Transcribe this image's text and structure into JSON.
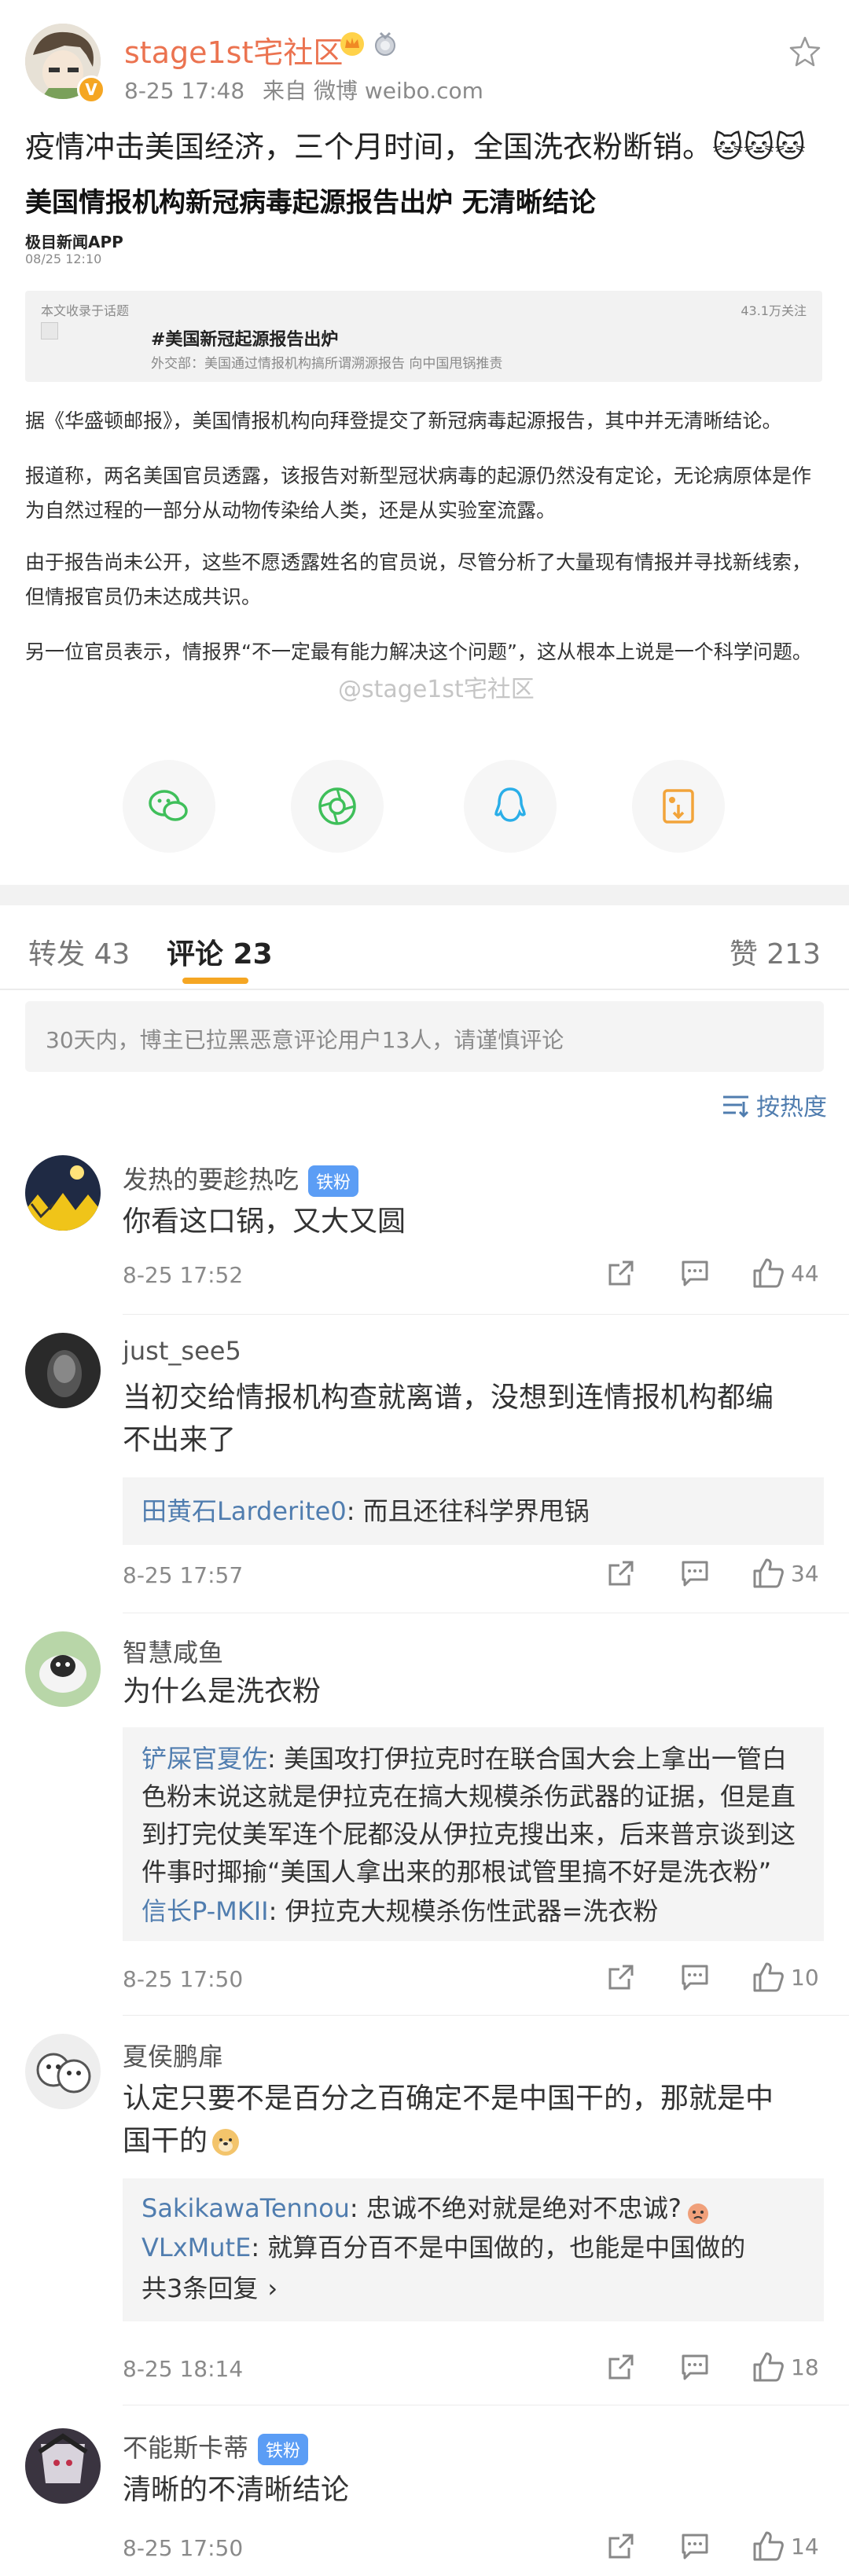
{
  "post": {
    "user": "stage1st宅社区",
    "time": "8-25 17:48",
    "source_prefix": "来自",
    "source": "微博 weibo.com",
    "text": "疫情冲击美国经济，三个月时间，全国洗衣粉断销。",
    "emoji": "🐱🐱🐱"
  },
  "article": {
    "title": "美国情报机构新冠病毒起源报告出炉 无清晰结论",
    "publisher": "极目新闻APP",
    "date": "08/25 12:10",
    "card_top_left": "本文收录于话题",
    "card_top_right": "43.1万关注",
    "topic": "#美国新冠起源报告出炉",
    "topic_sub": "外交部：美国通过情报机构搞所谓溯源报告 向中国甩锅推责",
    "para1": "据《华盛顿邮报》，美国情报机构向拜登提交了新冠病毒起源报告，其中并无清晰结论。",
    "para2": "报道称，两名美国官员透露，该报告对新型冠状病毒的起源仍然没有定论，无论病原体是作为自然过程的一部分从动物传染给人类，还是从实验室流露。",
    "para3": "由于报告尚未公开，这些不愿透露姓名的官员说，尽管分析了大量现有情报并寻找新线索，但情报官员仍未达成共识。",
    "para4": "另一位官员表示，情报界“不一定最有能力解决这个问题”，这从根本上说是一个科学问题。",
    "watermark": "@stage1st宅社区"
  },
  "tabs": {
    "repost": "转发 43",
    "comment": "评论 23",
    "like": "赞 213"
  },
  "notice": "30天内，博主已拉黑恶意评论用户13人，请谨慎评论",
  "sort_label": "按热度",
  "fan_badge": "铁粉",
  "comments": [
    {
      "name": "发热的要趁热吃",
      "text": "你看这口锅，又大又圆",
      "time": "8-25 17:52",
      "likes": "44"
    },
    {
      "name": "just_see5",
      "text1": "当初交给情报机构查就离谱，没想到连情报机构都编",
      "text2": "不出来了",
      "reply_user": "田黄石Larderite0",
      "reply_text": ": 而且还往科学界甩锅",
      "time": "8-25 17:57",
      "likes": "34"
    },
    {
      "name": "智慧咸鱼",
      "text": "为什么是洗衣粉",
      "reply1_user": "铲屎官夏佐",
      "reply1_l1": ": 美国攻打伊拉克时在联合国大会上拿出一管白",
      "reply1_l2": "色粉末说这就是伊拉克在搞大规模杀伤武器的证据，但是直",
      "reply1_l3": "到打完仗美军连个屁都没从伊拉克搜出来，后来普京谈到这",
      "reply1_l4": "件事时揶揄“美国人拿出来的那根试管里搞不好是洗衣粉”",
      "reply2_user": "信长P-MKII",
      "reply2_text": ": 伊拉克大规模杀伤性武器=洗衣粉",
      "time": "8-25 17:50",
      "likes": "10"
    },
    {
      "name": "夏侯鹏扉",
      "text1": "认定只要不是百分之百确定不是中国干的，那就是中",
      "text2": "国干的",
      "reply1_user": "SakikawaTennou",
      "reply1_text": ": 忠诚不绝对就是绝对不忠诚?",
      "reply2_user": "VLxMutE",
      "reply2_text": ": 就算百分百不是中国做的，也能是中国做的",
      "more": "共3条回复",
      "time": "8-25 18:14",
      "likes": "18"
    },
    {
      "name": "不能斯卡蒂",
      "text": "清晰的不清晰结论",
      "time": "8-25 17:50",
      "likes": "14"
    }
  ]
}
